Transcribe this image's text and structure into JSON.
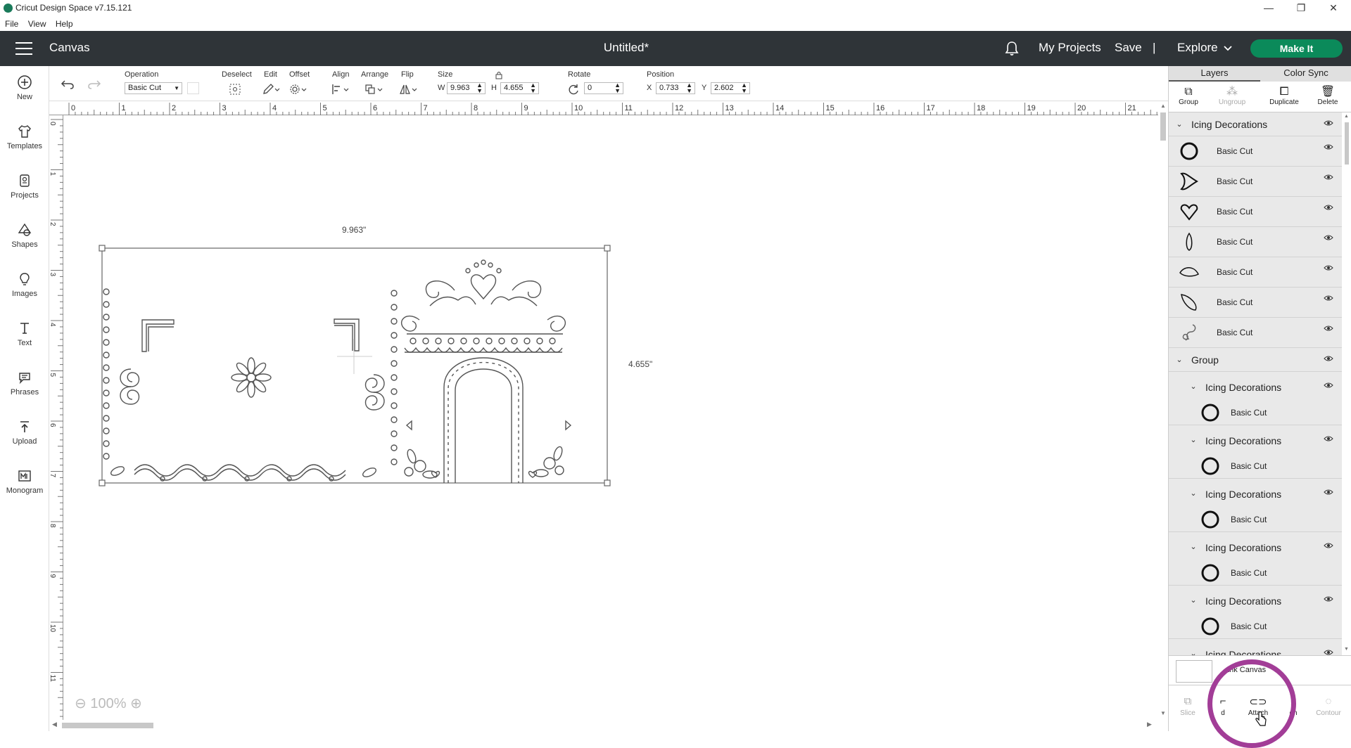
{
  "window": {
    "title": "Cricut Design Space  v7.15.121",
    "controls": {
      "minimize": "—",
      "maximize": "❐",
      "close": "✕"
    }
  },
  "menubar": [
    "File",
    "View",
    "Help"
  ],
  "header": {
    "section": "Canvas",
    "doc_title": "Untitled*",
    "my_projects": "My Projects",
    "save": "Save",
    "separator": "|",
    "explore": "Explore",
    "make_it": "Make It",
    "accent_color": "#0b8a5a",
    "bar_color": "#2f3438"
  },
  "sidebar": {
    "items": [
      {
        "label": "New",
        "icon": "plus-circle-icon"
      },
      {
        "label": "Templates",
        "icon": "shirt-icon"
      },
      {
        "label": "Projects",
        "icon": "projects-icon"
      },
      {
        "label": "Shapes",
        "icon": "shapes-icon"
      },
      {
        "label": "Images",
        "icon": "lightbulb-icon"
      },
      {
        "label": "Text",
        "icon": "text-icon"
      },
      {
        "label": "Phrases",
        "icon": "speech-bubble-icon"
      },
      {
        "label": "Upload",
        "icon": "upload-icon"
      },
      {
        "label": "Monogram",
        "icon": "monogram-icon"
      }
    ]
  },
  "toolbar": {
    "operation_label": "Operation",
    "operation_value": "Basic Cut",
    "deselect_label": "Deselect",
    "edit_label": "Edit",
    "offset_label": "Offset",
    "align_label": "Align",
    "arrange_label": "Arrange",
    "flip_label": "Flip",
    "size_label": "Size",
    "w_label": "W",
    "w_value": "9.963",
    "h_label": "H",
    "h_value": "4.655",
    "rotate_label": "Rotate",
    "rotate_value": "0",
    "position_label": "Position",
    "x_label": "X",
    "x_value": "0.733",
    "y_label": "Y",
    "y_value": "2.602"
  },
  "ruler": {
    "top": [
      "0",
      "1",
      "2",
      "3",
      "4",
      "5",
      "6",
      "7",
      "8",
      "9",
      "10",
      "11",
      "12",
      "13",
      "14",
      "15",
      "16",
      "17",
      "18",
      "19",
      "20",
      "21"
    ],
    "left": [
      "0",
      "1",
      "2",
      "3",
      "4",
      "5",
      "6",
      "7",
      "8",
      "9",
      "10",
      "11"
    ]
  },
  "canvas": {
    "width_dim": "9.963\"",
    "height_dim": "4.655\"",
    "zoom_level": "100%"
  },
  "panel": {
    "tabs": [
      "Layers",
      "Color Sync"
    ],
    "actions": [
      {
        "label": "Group",
        "enabled": true
      },
      {
        "label": "Ungroup",
        "enabled": false
      },
      {
        "label": "Duplicate",
        "enabled": true
      },
      {
        "label": "Delete",
        "enabled": true
      }
    ],
    "top_group": "Icing Decorations",
    "top_leaves": [
      "Basic Cut",
      "Basic Cut",
      "Basic Cut",
      "Basic Cut",
      "Basic Cut",
      "Basic Cut",
      "Basic Cut"
    ],
    "group_label": "Group",
    "sub_groups": [
      {
        "name": "Icing Decorations",
        "leaf": "Basic Cut"
      },
      {
        "name": "Icing Decorations",
        "leaf": "Basic Cut"
      },
      {
        "name": "Icing Decorations",
        "leaf": "Basic Cut"
      },
      {
        "name": "Icing Decorations",
        "leaf": "Basic Cut"
      },
      {
        "name": "Icing Decorations",
        "leaf": "Basic Cut"
      },
      {
        "name": "Icing Decorations"
      }
    ],
    "blank_canvas": "ank Canvas",
    "bottom_actions": [
      "Slice",
      "d",
      "Attach",
      "en",
      "Contour"
    ]
  }
}
